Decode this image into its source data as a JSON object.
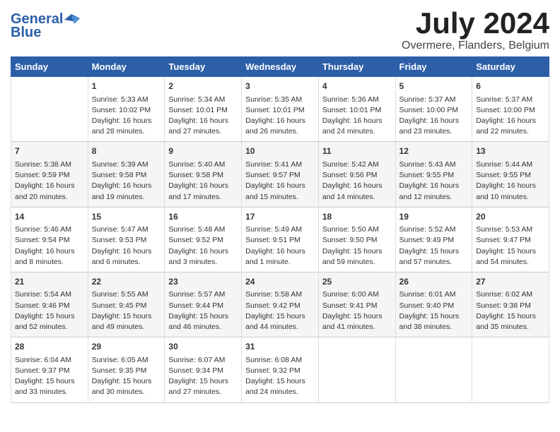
{
  "logo": {
    "line1": "General",
    "line2": "Blue"
  },
  "title": "July 2024",
  "subtitle": "Overmere, Flanders, Belgium",
  "days_of_week": [
    "Sunday",
    "Monday",
    "Tuesday",
    "Wednesday",
    "Thursday",
    "Friday",
    "Saturday"
  ],
  "weeks": [
    [
      {
        "num": "",
        "content": ""
      },
      {
        "num": "1",
        "content": "Sunrise: 5:33 AM\nSunset: 10:02 PM\nDaylight: 16 hours\nand 28 minutes."
      },
      {
        "num": "2",
        "content": "Sunrise: 5:34 AM\nSunset: 10:01 PM\nDaylight: 16 hours\nand 27 minutes."
      },
      {
        "num": "3",
        "content": "Sunrise: 5:35 AM\nSunset: 10:01 PM\nDaylight: 16 hours\nand 26 minutes."
      },
      {
        "num": "4",
        "content": "Sunrise: 5:36 AM\nSunset: 10:01 PM\nDaylight: 16 hours\nand 24 minutes."
      },
      {
        "num": "5",
        "content": "Sunrise: 5:37 AM\nSunset: 10:00 PM\nDaylight: 16 hours\nand 23 minutes."
      },
      {
        "num": "6",
        "content": "Sunrise: 5:37 AM\nSunset: 10:00 PM\nDaylight: 16 hours\nand 22 minutes."
      }
    ],
    [
      {
        "num": "7",
        "content": "Sunrise: 5:38 AM\nSunset: 9:59 PM\nDaylight: 16 hours\nand 20 minutes."
      },
      {
        "num": "8",
        "content": "Sunrise: 5:39 AM\nSunset: 9:58 PM\nDaylight: 16 hours\nand 19 minutes."
      },
      {
        "num": "9",
        "content": "Sunrise: 5:40 AM\nSunset: 9:58 PM\nDaylight: 16 hours\nand 17 minutes."
      },
      {
        "num": "10",
        "content": "Sunrise: 5:41 AM\nSunset: 9:57 PM\nDaylight: 16 hours\nand 15 minutes."
      },
      {
        "num": "11",
        "content": "Sunrise: 5:42 AM\nSunset: 9:56 PM\nDaylight: 16 hours\nand 14 minutes."
      },
      {
        "num": "12",
        "content": "Sunrise: 5:43 AM\nSunset: 9:55 PM\nDaylight: 16 hours\nand 12 minutes."
      },
      {
        "num": "13",
        "content": "Sunrise: 5:44 AM\nSunset: 9:55 PM\nDaylight: 16 hours\nand 10 minutes."
      }
    ],
    [
      {
        "num": "14",
        "content": "Sunrise: 5:46 AM\nSunset: 9:54 PM\nDaylight: 16 hours\nand 8 minutes."
      },
      {
        "num": "15",
        "content": "Sunrise: 5:47 AM\nSunset: 9:53 PM\nDaylight: 16 hours\nand 6 minutes."
      },
      {
        "num": "16",
        "content": "Sunrise: 5:48 AM\nSunset: 9:52 PM\nDaylight: 16 hours\nand 3 minutes."
      },
      {
        "num": "17",
        "content": "Sunrise: 5:49 AM\nSunset: 9:51 PM\nDaylight: 16 hours\nand 1 minute."
      },
      {
        "num": "18",
        "content": "Sunrise: 5:50 AM\nSunset: 9:50 PM\nDaylight: 15 hours\nand 59 minutes."
      },
      {
        "num": "19",
        "content": "Sunrise: 5:52 AM\nSunset: 9:49 PM\nDaylight: 15 hours\nand 57 minutes."
      },
      {
        "num": "20",
        "content": "Sunrise: 5:53 AM\nSunset: 9:47 PM\nDaylight: 15 hours\nand 54 minutes."
      }
    ],
    [
      {
        "num": "21",
        "content": "Sunrise: 5:54 AM\nSunset: 9:46 PM\nDaylight: 15 hours\nand 52 minutes."
      },
      {
        "num": "22",
        "content": "Sunrise: 5:55 AM\nSunset: 9:45 PM\nDaylight: 15 hours\nand 49 minutes."
      },
      {
        "num": "23",
        "content": "Sunrise: 5:57 AM\nSunset: 9:44 PM\nDaylight: 15 hours\nand 46 minutes."
      },
      {
        "num": "24",
        "content": "Sunrise: 5:58 AM\nSunset: 9:42 PM\nDaylight: 15 hours\nand 44 minutes."
      },
      {
        "num": "25",
        "content": "Sunrise: 6:00 AM\nSunset: 9:41 PM\nDaylight: 15 hours\nand 41 minutes."
      },
      {
        "num": "26",
        "content": "Sunrise: 6:01 AM\nSunset: 9:40 PM\nDaylight: 15 hours\nand 38 minutes."
      },
      {
        "num": "27",
        "content": "Sunrise: 6:02 AM\nSunset: 9:38 PM\nDaylight: 15 hours\nand 35 minutes."
      }
    ],
    [
      {
        "num": "28",
        "content": "Sunrise: 6:04 AM\nSunset: 9:37 PM\nDaylight: 15 hours\nand 33 minutes."
      },
      {
        "num": "29",
        "content": "Sunrise: 6:05 AM\nSunset: 9:35 PM\nDaylight: 15 hours\nand 30 minutes."
      },
      {
        "num": "30",
        "content": "Sunrise: 6:07 AM\nSunset: 9:34 PM\nDaylight: 15 hours\nand 27 minutes."
      },
      {
        "num": "31",
        "content": "Sunrise: 6:08 AM\nSunset: 9:32 PM\nDaylight: 15 hours\nand 24 minutes."
      },
      {
        "num": "",
        "content": ""
      },
      {
        "num": "",
        "content": ""
      },
      {
        "num": "",
        "content": ""
      }
    ]
  ]
}
